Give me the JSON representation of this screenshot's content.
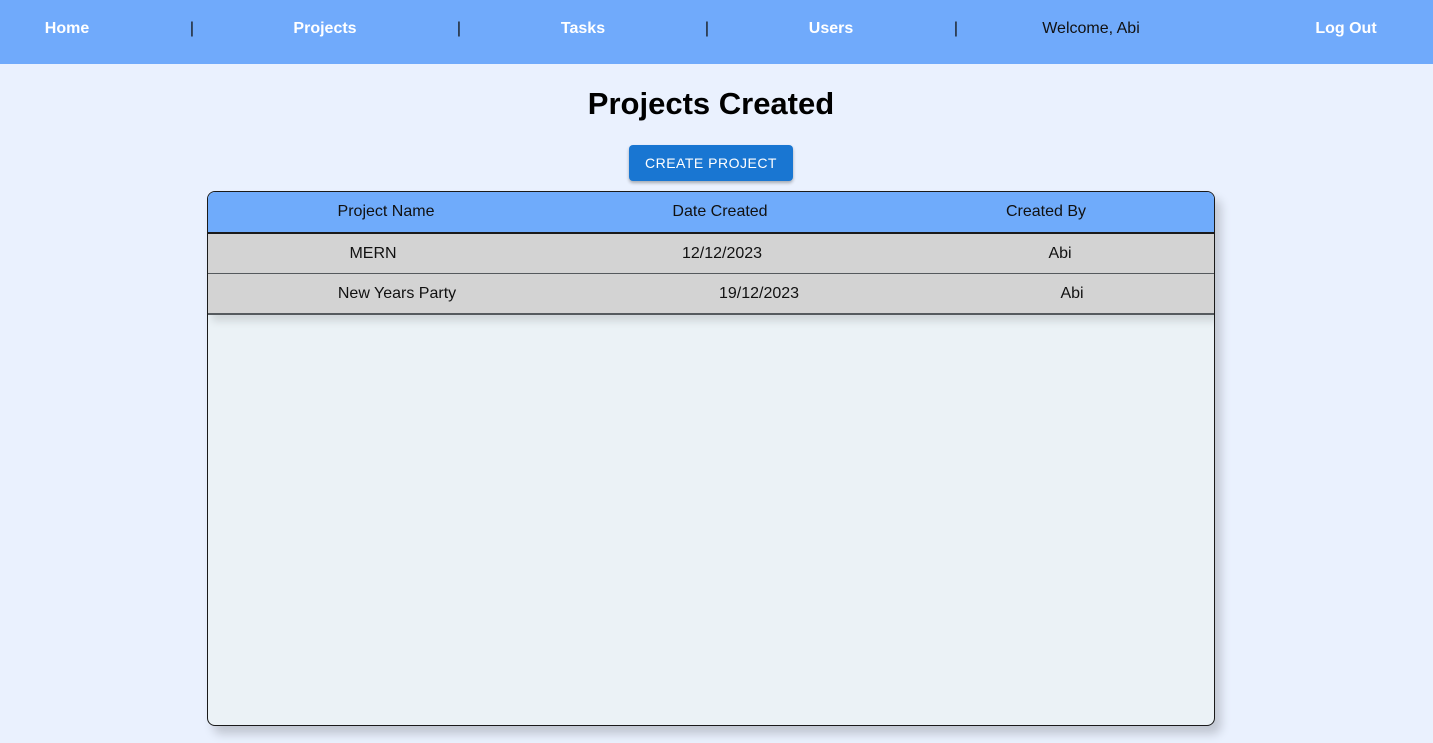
{
  "nav": {
    "home": "Home",
    "projects": "Projects",
    "tasks": "Tasks",
    "users": "Users",
    "separator": "|",
    "welcome": "Welcome, Abi",
    "logout": "Log Out"
  },
  "page": {
    "title": "Projects Created",
    "create_button": "CREATE PROJECT"
  },
  "table": {
    "headers": [
      "Project Name",
      "Date Created",
      "Created By"
    ],
    "rows": [
      [
        "MERN",
        "12/12/2023",
        "Abi"
      ],
      [
        "New Years Party",
        "19/12/2023",
        "Abi"
      ]
    ]
  },
  "colors": {
    "navbar": "#70aafb",
    "page_background": "#eaf1fe",
    "button": "#1976d2",
    "row": "#d3d3d3"
  }
}
